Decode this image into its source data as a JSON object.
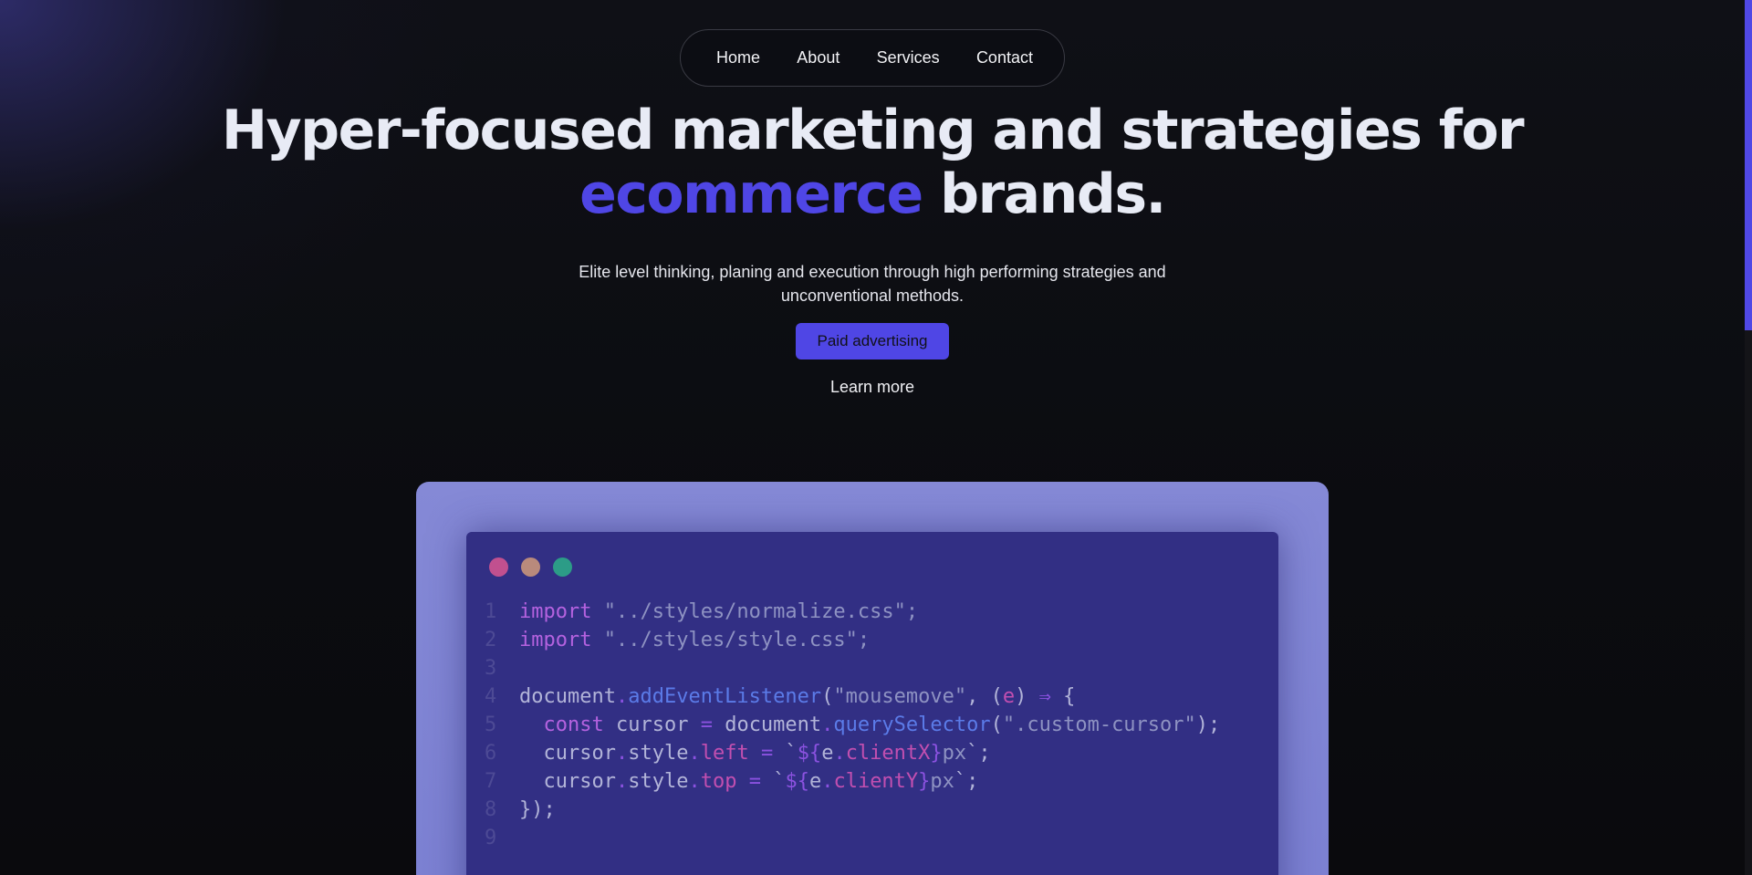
{
  "nav": {
    "items": [
      {
        "label": "Home"
      },
      {
        "label": "About"
      },
      {
        "label": "Services"
      },
      {
        "label": "Contact"
      }
    ]
  },
  "hero": {
    "title_line1": "Hyper-focused marketing and strategies for",
    "title_accent": "ecommerce",
    "title_end": " brands.",
    "subtitle": "Elite level thinking, planing and execution through high performing strategies and unconventional methods.",
    "cta_label": "Paid advertising",
    "learn_more": "Learn more"
  },
  "colors": {
    "accent": "#4f46e5",
    "dot_red": "#c1508f",
    "dot_yellow": "#b98a7c",
    "dot_green": "#2c9c87"
  },
  "code": {
    "lines": [
      {
        "n": "1",
        "tokens": [
          [
            "kw",
            "import"
          ],
          [
            "plain",
            " "
          ],
          [
            "str",
            "\"../styles/normalize.css\";"
          ]
        ]
      },
      {
        "n": "2",
        "tokens": [
          [
            "kw",
            "import"
          ],
          [
            "plain",
            " "
          ],
          [
            "str",
            "\"../styles/style.css\";"
          ]
        ]
      },
      {
        "n": "3",
        "tokens": []
      },
      {
        "n": "4",
        "tokens": [
          [
            "plain",
            "document"
          ],
          [
            "op",
            "."
          ],
          [
            "fn",
            "addEventListener"
          ],
          [
            "plain",
            "("
          ],
          [
            "str",
            "\"mousemove\""
          ],
          [
            "plain",
            ", ("
          ],
          [
            "param",
            "e"
          ],
          [
            "plain",
            ") "
          ],
          [
            "op",
            "⇒"
          ],
          [
            "plain",
            " {"
          ]
        ]
      },
      {
        "n": "5",
        "tokens": [
          [
            "plain",
            "  "
          ],
          [
            "kw",
            "const"
          ],
          [
            "plain",
            " cursor "
          ],
          [
            "op",
            "="
          ],
          [
            "plain",
            " document"
          ],
          [
            "op",
            "."
          ],
          [
            "fn",
            "querySelector"
          ],
          [
            "plain",
            "("
          ],
          [
            "str",
            "\".custom-cursor\""
          ],
          [
            "plain",
            ");"
          ]
        ]
      },
      {
        "n": "6",
        "tokens": [
          [
            "plain",
            "  cursor"
          ],
          [
            "op",
            "."
          ],
          [
            "plain",
            "style"
          ],
          [
            "op",
            "."
          ],
          [
            "prop",
            "left"
          ],
          [
            "plain",
            " "
          ],
          [
            "op",
            "="
          ],
          [
            "plain",
            " `"
          ],
          [
            "op",
            "${"
          ],
          [
            "plain",
            "e"
          ],
          [
            "op",
            "."
          ],
          [
            "prop",
            "clientX"
          ],
          [
            "op",
            "}"
          ],
          [
            "str",
            "px"
          ],
          [
            "plain",
            "`;"
          ]
        ]
      },
      {
        "n": "7",
        "tokens": [
          [
            "plain",
            "  cursor"
          ],
          [
            "op",
            "."
          ],
          [
            "plain",
            "style"
          ],
          [
            "op",
            "."
          ],
          [
            "prop",
            "top"
          ],
          [
            "plain",
            " "
          ],
          [
            "op",
            "="
          ],
          [
            "plain",
            " `"
          ],
          [
            "op",
            "${"
          ],
          [
            "plain",
            "e"
          ],
          [
            "op",
            "."
          ],
          [
            "prop",
            "clientY"
          ],
          [
            "op",
            "}"
          ],
          [
            "str",
            "px"
          ],
          [
            "plain",
            "`;"
          ]
        ]
      },
      {
        "n": "8",
        "tokens": [
          [
            "plain",
            "});"
          ]
        ]
      },
      {
        "n": "9",
        "tokens": []
      }
    ]
  }
}
